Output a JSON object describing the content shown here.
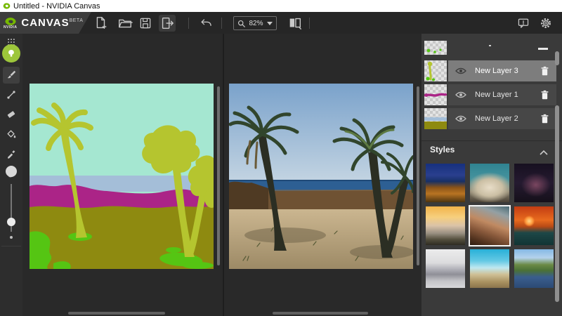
{
  "window": {
    "title": "Untitled - NVIDIA Canvas"
  },
  "toolbar": {
    "brand": "NVIDIA",
    "app_name": "CANVAS",
    "beta": "BETA",
    "zoom": "82%"
  },
  "panels": {
    "layers": [
      {
        "label": "New Layer 3",
        "selected": true
      },
      {
        "label": "New Layer 1",
        "selected": false
      },
      {
        "label": "New Layer 2",
        "selected": false
      }
    ],
    "styles": {
      "title": "Styles",
      "selected_index": 4,
      "items": [
        {
          "name": "desert-lightning-night",
          "background": "linear-gradient(180deg,#16307e 0%,#2a3f8e 30%,#173066 46%,#8a5318 62%,#b87422 78%,#4e3410 100%)"
        },
        {
          "name": "cloud-over-teal-peak",
          "background": "radial-gradient(ellipse 80% 55% at 50% 62%, #e8ddc8 0%, #cbbfa4 40%, rgba(200,190,160,0) 72%), linear-gradient(180deg,#2f8391 0%,#45939e 40%,#8c8470 72%,#4a4236 100%)"
        },
        {
          "name": "night-sky-arch",
          "background": "radial-gradient(ellipse 60% 50% at 55% 55%, #7a4660 0%, rgba(60,30,50,0) 62%), linear-gradient(180deg,#171020 0%,#251a30 50%,#15101a 100%)"
        },
        {
          "name": "sunset-over-mist",
          "background": "linear-gradient(180deg,#f2b34a 0%,#f6cf7e 28%,#d9c2a8 50%,#978e80 70%,#55503e 85%,#2e2c22 100%)"
        },
        {
          "name": "rocky-peak",
          "background": "linear-gradient(200deg,#4a6a74 0%,#93a0a4 20%,#c08a62 45%,#8a5a3c 65%,#53331f 85%,#2e1d12 100%)"
        },
        {
          "name": "red-sunset-coast",
          "background": "radial-gradient(circle 8px at 38% 38%, #ffd98a 0%, #ff9c3f 60%, rgba(255,150,60,0) 100%), linear-gradient(180deg,#c23c12 0%,#e86a1e 35%,#b84a16 52%,#1d4747 68%,#123434 100%)"
        },
        {
          "name": "foggy-monochrome-peaks",
          "background": "linear-gradient(180deg,#ececec 0%,#dcdcde 35%,#a8a8b0 55%,#8f8f97 65%,#c4c4c8 82%,#d8d8da 100%)"
        },
        {
          "name": "tropical-beach",
          "background": "linear-gradient(180deg,#28b0d8 0%,#64c9e4 30%,#bfe8f0 48%,#cfc096 65%,#a8905f 85%,#8a744c 100%)"
        },
        {
          "name": "alpine-lake-reflection",
          "background": "linear-gradient(180deg,#84b8e4 0%,#b4d2ec 22%,#6b8a46 40%,#4a7036 55%,#3a5e8e 72%,#2c4a74 100%)"
        }
      ]
    }
  },
  "palette": {
    "nvidia-green": "#76b900",
    "material-green": "#9dc63b",
    "seg-sky": "#a5e7d1",
    "seg-water": "#a4bed8",
    "seg-rock": "#ab2487",
    "seg-ground": "#8e8a10",
    "seg-grass": "#55c513",
    "seg-tree": "#b5c52f",
    "photo-sky-top": "#7aa2cb",
    "photo-sky-bottom": "#c3d4e2",
    "photo-sea": "#2d5f93",
    "photo-sea-line": "#1f4a78",
    "photo-wall": "#6f5233",
    "photo-wall-dark": "#4f3a23",
    "photo-sand-light": "#cbb690",
    "photo-sand-dark": "#9d8a66",
    "photo-trunk": "#2b2e23",
    "photo-frond": "#31452c",
    "photo-frond-light": "#5d7a43",
    "photo-dead-frond": "#6a5a38"
  }
}
